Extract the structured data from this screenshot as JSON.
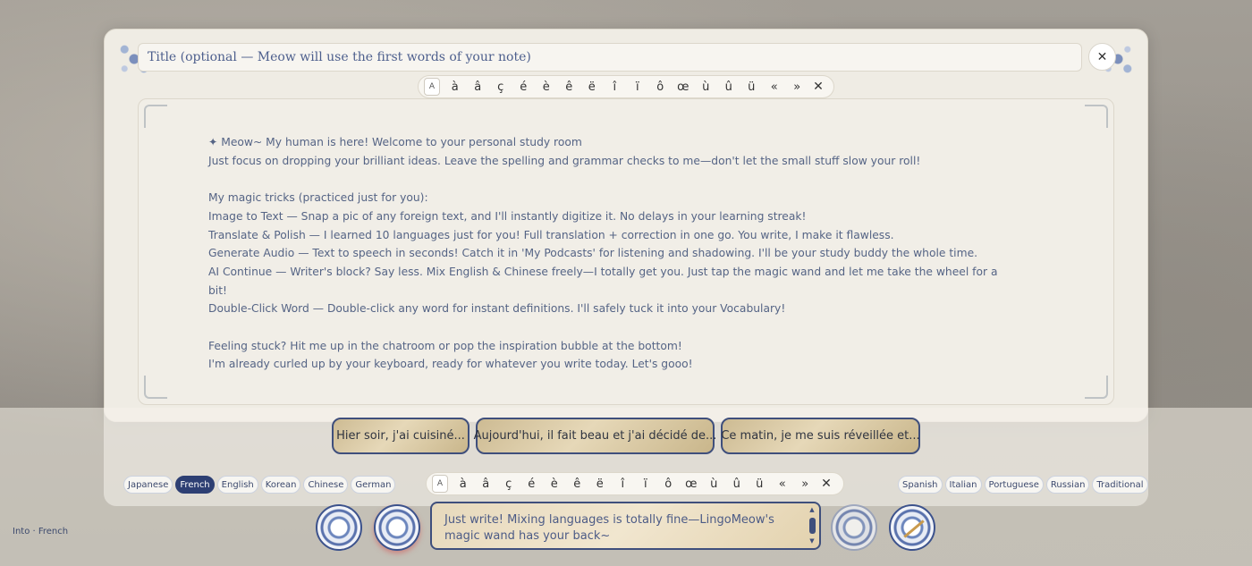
{
  "editor": {
    "title_placeholder": "Title (optional — Meow will use the first words of your note)",
    "close_symbol": "✕",
    "note_text": "✦ Meow~ My human is here! Welcome to your personal study room\nJust focus on dropping your brilliant ideas. Leave the spelling and grammar checks to me—don't let the small stuff slow your roll!\n\nMy magic tricks (practiced just for you):\nImage to Text — Snap a pic of any foreign text, and I'll instantly digitize it. No delays in your learning streak!\nTranslate & Polish — I learned 10 languages just for you! Full translation + correction in one go. You write, I make it flawless.\nGenerate Audio — Text to speech in seconds! Catch it in 'My Podcasts' for listening and shadowing. I'll be your study buddy the whole time.\nAI Continue — Writer's block? Say less. Mix English & Chinese freely—I totally get you. Just tap the magic wand and let me take the wheel for a bit!\nDouble-Click Word — Double-click any word for instant definitions. I'll safely tuck it into your Vocabulary!\n\nFeeling stuck? Hit me up in the chatroom or pop the inspiration bubble at the bottom!\nI'm already curled up by your keyboard, ready for whatever you write today. Let's gooo!"
  },
  "char_bar": {
    "toggle": "A",
    "chars": [
      "à",
      "â",
      "ç",
      "é",
      "è",
      "ê",
      "ë",
      "î",
      "ï",
      "ô",
      "œ",
      "ù",
      "û",
      "ü",
      "«",
      "»"
    ],
    "close": "✕"
  },
  "suggestions": [
    "Hier soir, j'ai cuisiné...",
    "Aujourd'hui, il fait beau et j'ai décidé de...",
    "Ce matin, je me suis réveillée et..."
  ],
  "languages_left": [
    "Japanese",
    "French",
    "English",
    "Korean",
    "Chinese",
    "German"
  ],
  "languages_right": [
    "Spanish",
    "Italian",
    "Portuguese",
    "Russian",
    "Traditional"
  ],
  "active_language": "French",
  "into_label": "Into · French",
  "chat": {
    "placeholder": "Just write! Mixing languages is totally fine—LingoMeow's magic wand has your back~"
  },
  "icons": {
    "scroll_up": "▲",
    "scroll_down": "▼"
  }
}
